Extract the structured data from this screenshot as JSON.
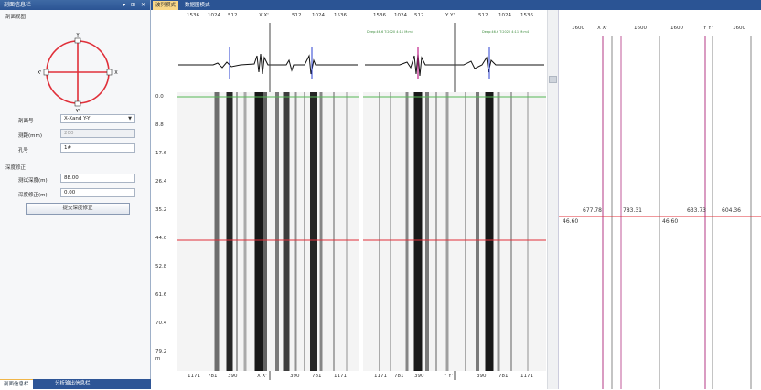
{
  "left_panel": {
    "title": "剖面信息栏",
    "title_controls": "▾ ⊞ ✕",
    "section_view": "剖面视图",
    "compass": {
      "top": "Y",
      "bottom": "Y'",
      "left": "X'",
      "right": "X"
    },
    "fields": [
      {
        "label": "剖面号",
        "value": "X-Xand Y-Y'",
        "type": "select"
      },
      {
        "label": "测距(mm)",
        "value": "200",
        "disabled": true
      },
      {
        "label": "孔号",
        "value": "1#"
      }
    ],
    "section_depth": "深度修正",
    "depth_fields": [
      {
        "label": "测试深度(m)",
        "value": "88.00"
      },
      {
        "label": "深度修正(m)",
        "value": "0.00"
      }
    ],
    "button": "提交深度修正",
    "tabs": [
      "剖面信息栏",
      "分析输出信息栏"
    ]
  },
  "view_tabs": [
    "波列模式",
    "数据图模式"
  ],
  "channels": [
    {
      "pair": "X X'",
      "top_axis": [
        "1536",
        "1024",
        "512",
        "",
        "512",
        "1024",
        "1536"
      ],
      "bottom_axis": [
        "1171",
        "781",
        "390",
        "X X'",
        "390",
        "781",
        "1171"
      ],
      "green": [
        "Deep:46.6 T:2020 4:11 (M:2)",
        "Deep:46.6 T:2020 4:11 (M:2)"
      ]
    },
    {
      "pair": "Y Y'",
      "top_axis": [
        "1536",
        "1024",
        "512",
        "",
        "512",
        "1024",
        "1536"
      ],
      "bottom_axis": [
        "1171",
        "781",
        "390",
        "Y Y'",
        "390",
        "781",
        "1171"
      ],
      "green": [
        "Deep:46.6 T:2020 4:11 M:m4",
        "Deep:46.6 T:2020 4:11 M:m4"
      ]
    }
  ],
  "depth_ticks": [
    "0.0",
    "8.8",
    "17.6",
    "26.4",
    "35.2",
    "44.0",
    "52.8",
    "61.6",
    "70.4",
    "79.2"
  ],
  "depth_unit": "m",
  "right_panel": {
    "top_labels": [
      "1600",
      "X X'",
      "1600",
      "1600",
      "Y Y'",
      "1600"
    ],
    "values": [
      "677.78",
      "783.31",
      "633.73",
      "604.36"
    ],
    "depth_values": [
      "46.60",
      "46.60"
    ]
  },
  "colors": {
    "titlebar": "#2b5494",
    "accent_red": "#e0303a",
    "grid_green": "#56b856",
    "marker_blue": "#2a3fd0",
    "marker_magenta": "#c0208a"
  }
}
